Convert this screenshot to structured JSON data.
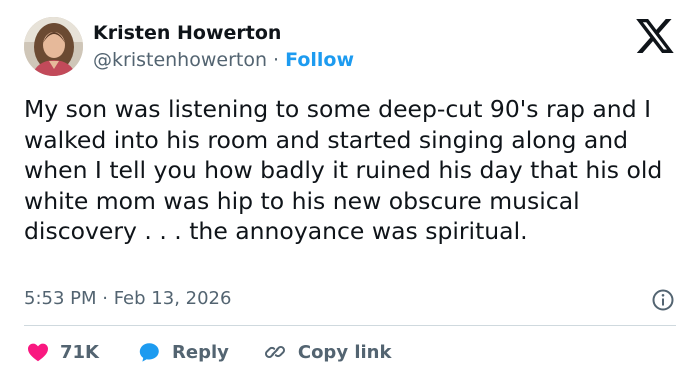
{
  "author": {
    "name": "Kristen Howerton",
    "handle": "@kristenhowerton",
    "separator": " · ",
    "follow_label": "Follow"
  },
  "post": {
    "text": "My son was listening to some deep-cut 90's rap and I walked into his room and started singing along and when I tell you how badly it ruined his day that his old white mom was hip to his new obscure musical discovery . . . the annoyance was spiritual.",
    "timestamp": "5:53 PM · Feb 13, 2026"
  },
  "actions": {
    "like_count": "71K",
    "reply_label": "Reply",
    "copy_label": "Copy link"
  },
  "colors": {
    "text": "#0f1419",
    "secondary": "#536471",
    "accent": "#1d9bf0",
    "like": "#f91880",
    "reply": "#1d9bf0",
    "divider": "#cfd9de"
  },
  "icons": [
    "avatar",
    "x-logo-icon",
    "info-icon",
    "heart-icon",
    "reply-bubble-icon",
    "link-icon"
  ]
}
